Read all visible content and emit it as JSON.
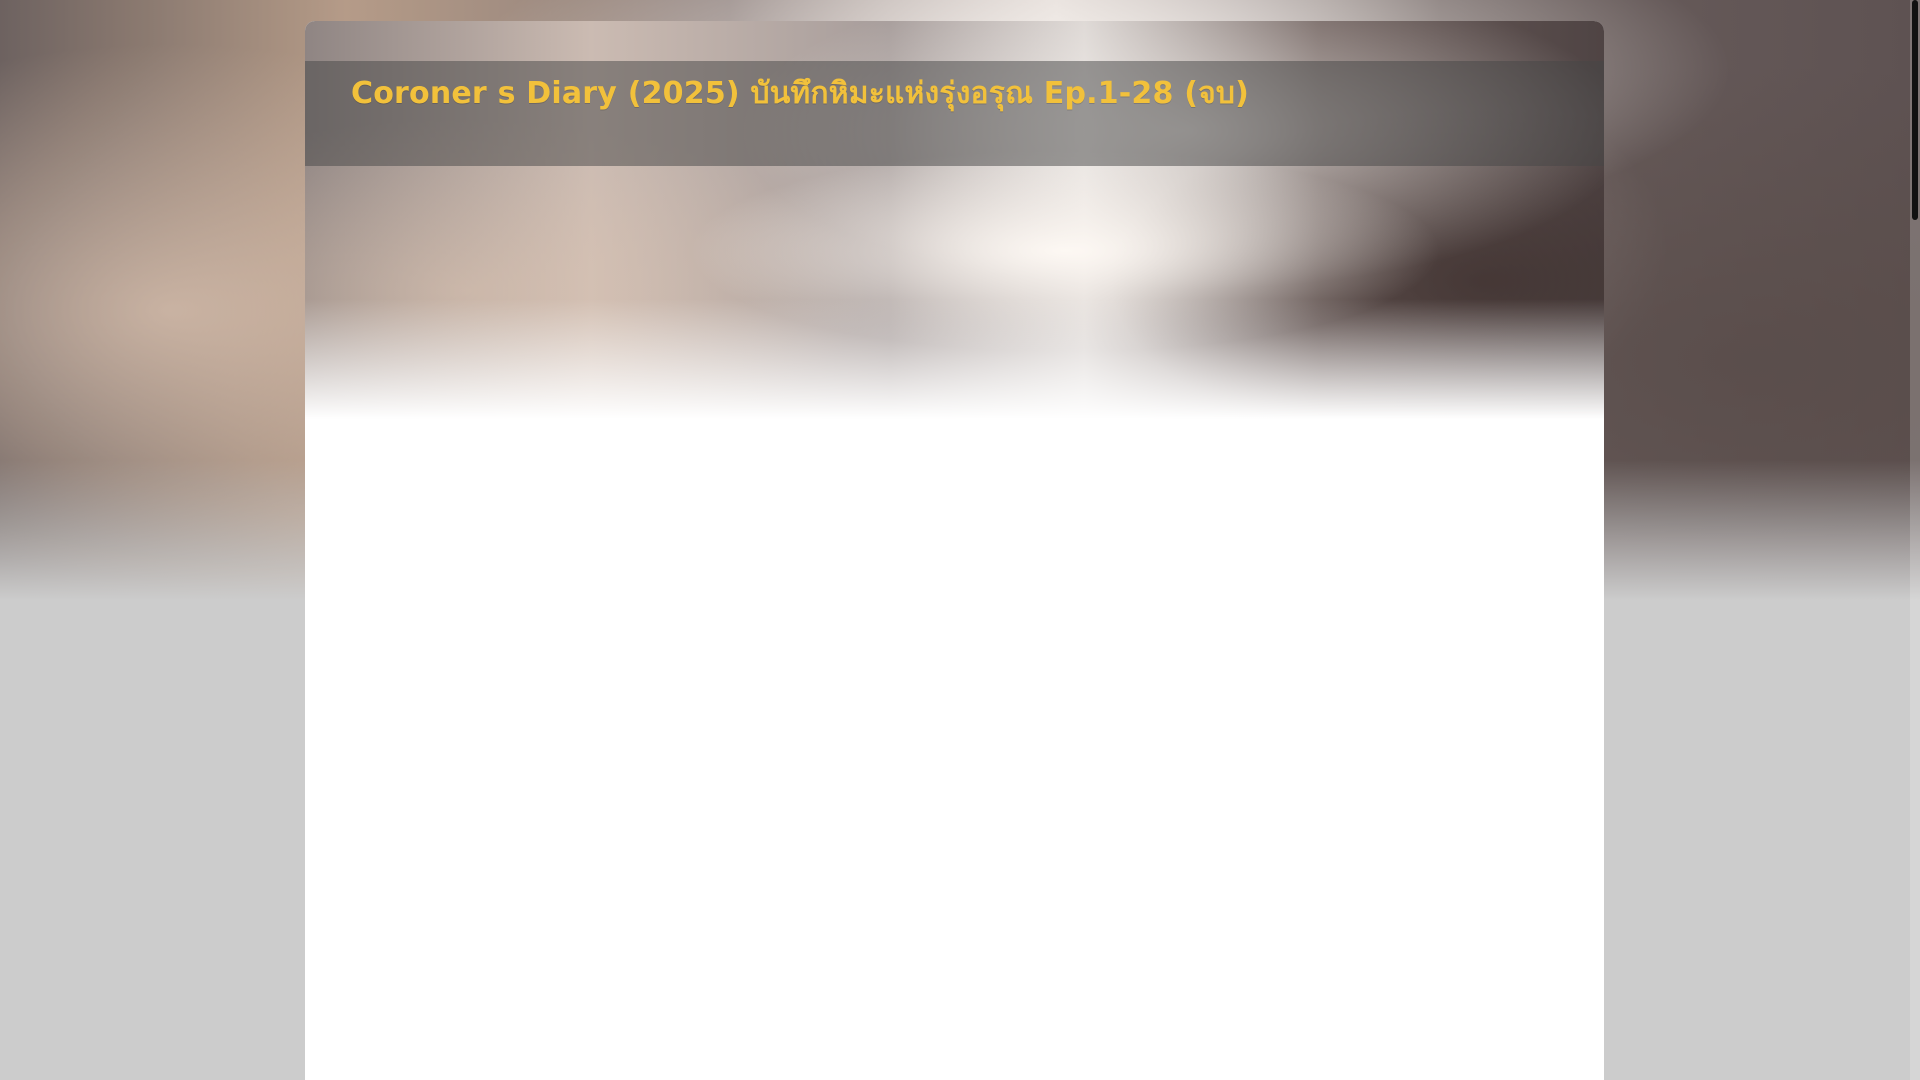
{
  "page": {
    "title": "Coroner s Diary (2025) บันทึกหิมะแห่งรุ่งอรุณ Ep.1-28 (จบ)"
  },
  "colors": {
    "title_text": "#f2c13b",
    "page_background": "#cccccc",
    "card_background": "#ffffff",
    "scrollbar_thumb": "#111111"
  }
}
